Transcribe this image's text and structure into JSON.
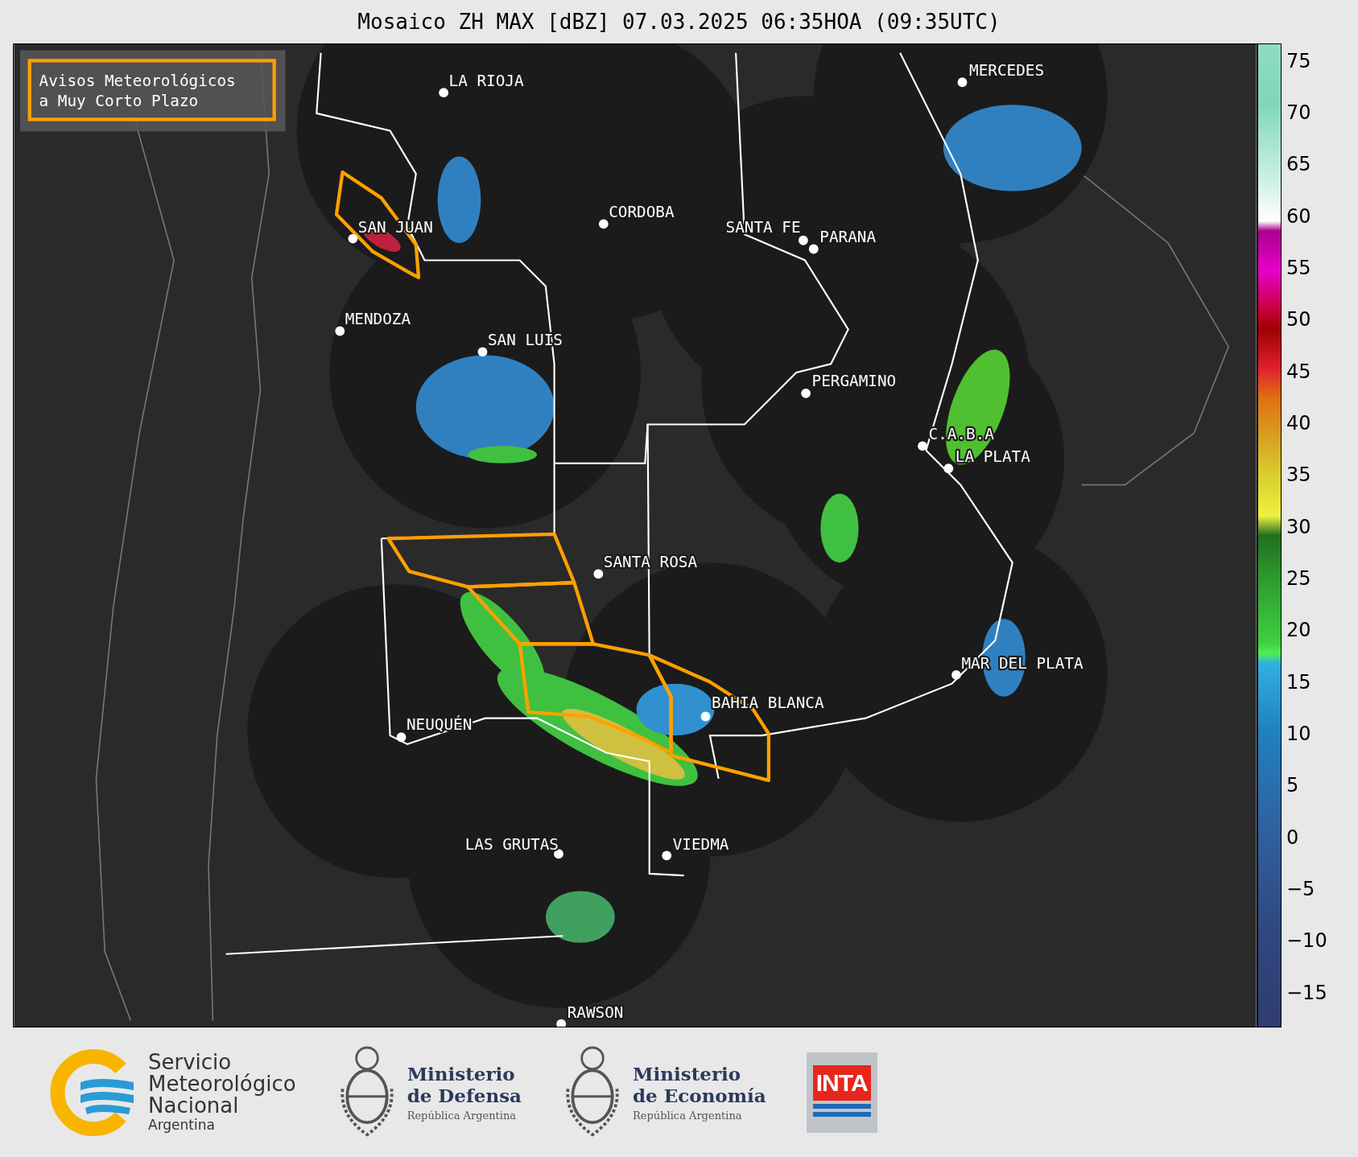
{
  "map": {
    "title": "Mosaico ZH MAX [dBZ] 07.03.2025 06:35HOA (09:35UTC)",
    "legend": {
      "lines": [
        "Avisos Meteorológicos",
        "a Muy Corto Plazo"
      ]
    },
    "cities": [
      "LA RIOJA",
      "SAN JUAN",
      "CORDOBA",
      "SANTA FE",
      "PARANA",
      "MERCEDES",
      "MENDOZA",
      "SAN LUIS",
      "PERGAMINO",
      "C.A.B.A",
      "LA PLATA",
      "SANTA ROSA",
      "MAR DEL PLATA",
      "BAHIA BLANCA",
      "NEUQUÉN",
      "LAS GRUTAS",
      "VIEDMA",
      "RAWSON"
    ]
  },
  "colorbar": {
    "ticks": [
      "75",
      "70",
      "65",
      "60",
      "55",
      "50",
      "45",
      "40",
      "35",
      "30",
      "25",
      "20",
      "15",
      "10",
      "5",
      "0",
      "−5",
      "−10",
      "−15"
    ]
  },
  "logos": [
    {
      "kind": "smn",
      "lines": [
        "Servicio",
        "Meteorológico",
        "Nacional"
      ],
      "subtitle": "Argentina"
    },
    {
      "kind": "ministry",
      "lines": [
        "Ministerio",
        "de Defensa"
      ],
      "subtitle": "República Argentina"
    },
    {
      "kind": "ministry",
      "lines": [
        "Ministerio",
        "de Economía"
      ],
      "subtitle": "República Argentina"
    },
    {
      "kind": "inta",
      "lines": [
        "INTA"
      ]
    }
  ]
}
